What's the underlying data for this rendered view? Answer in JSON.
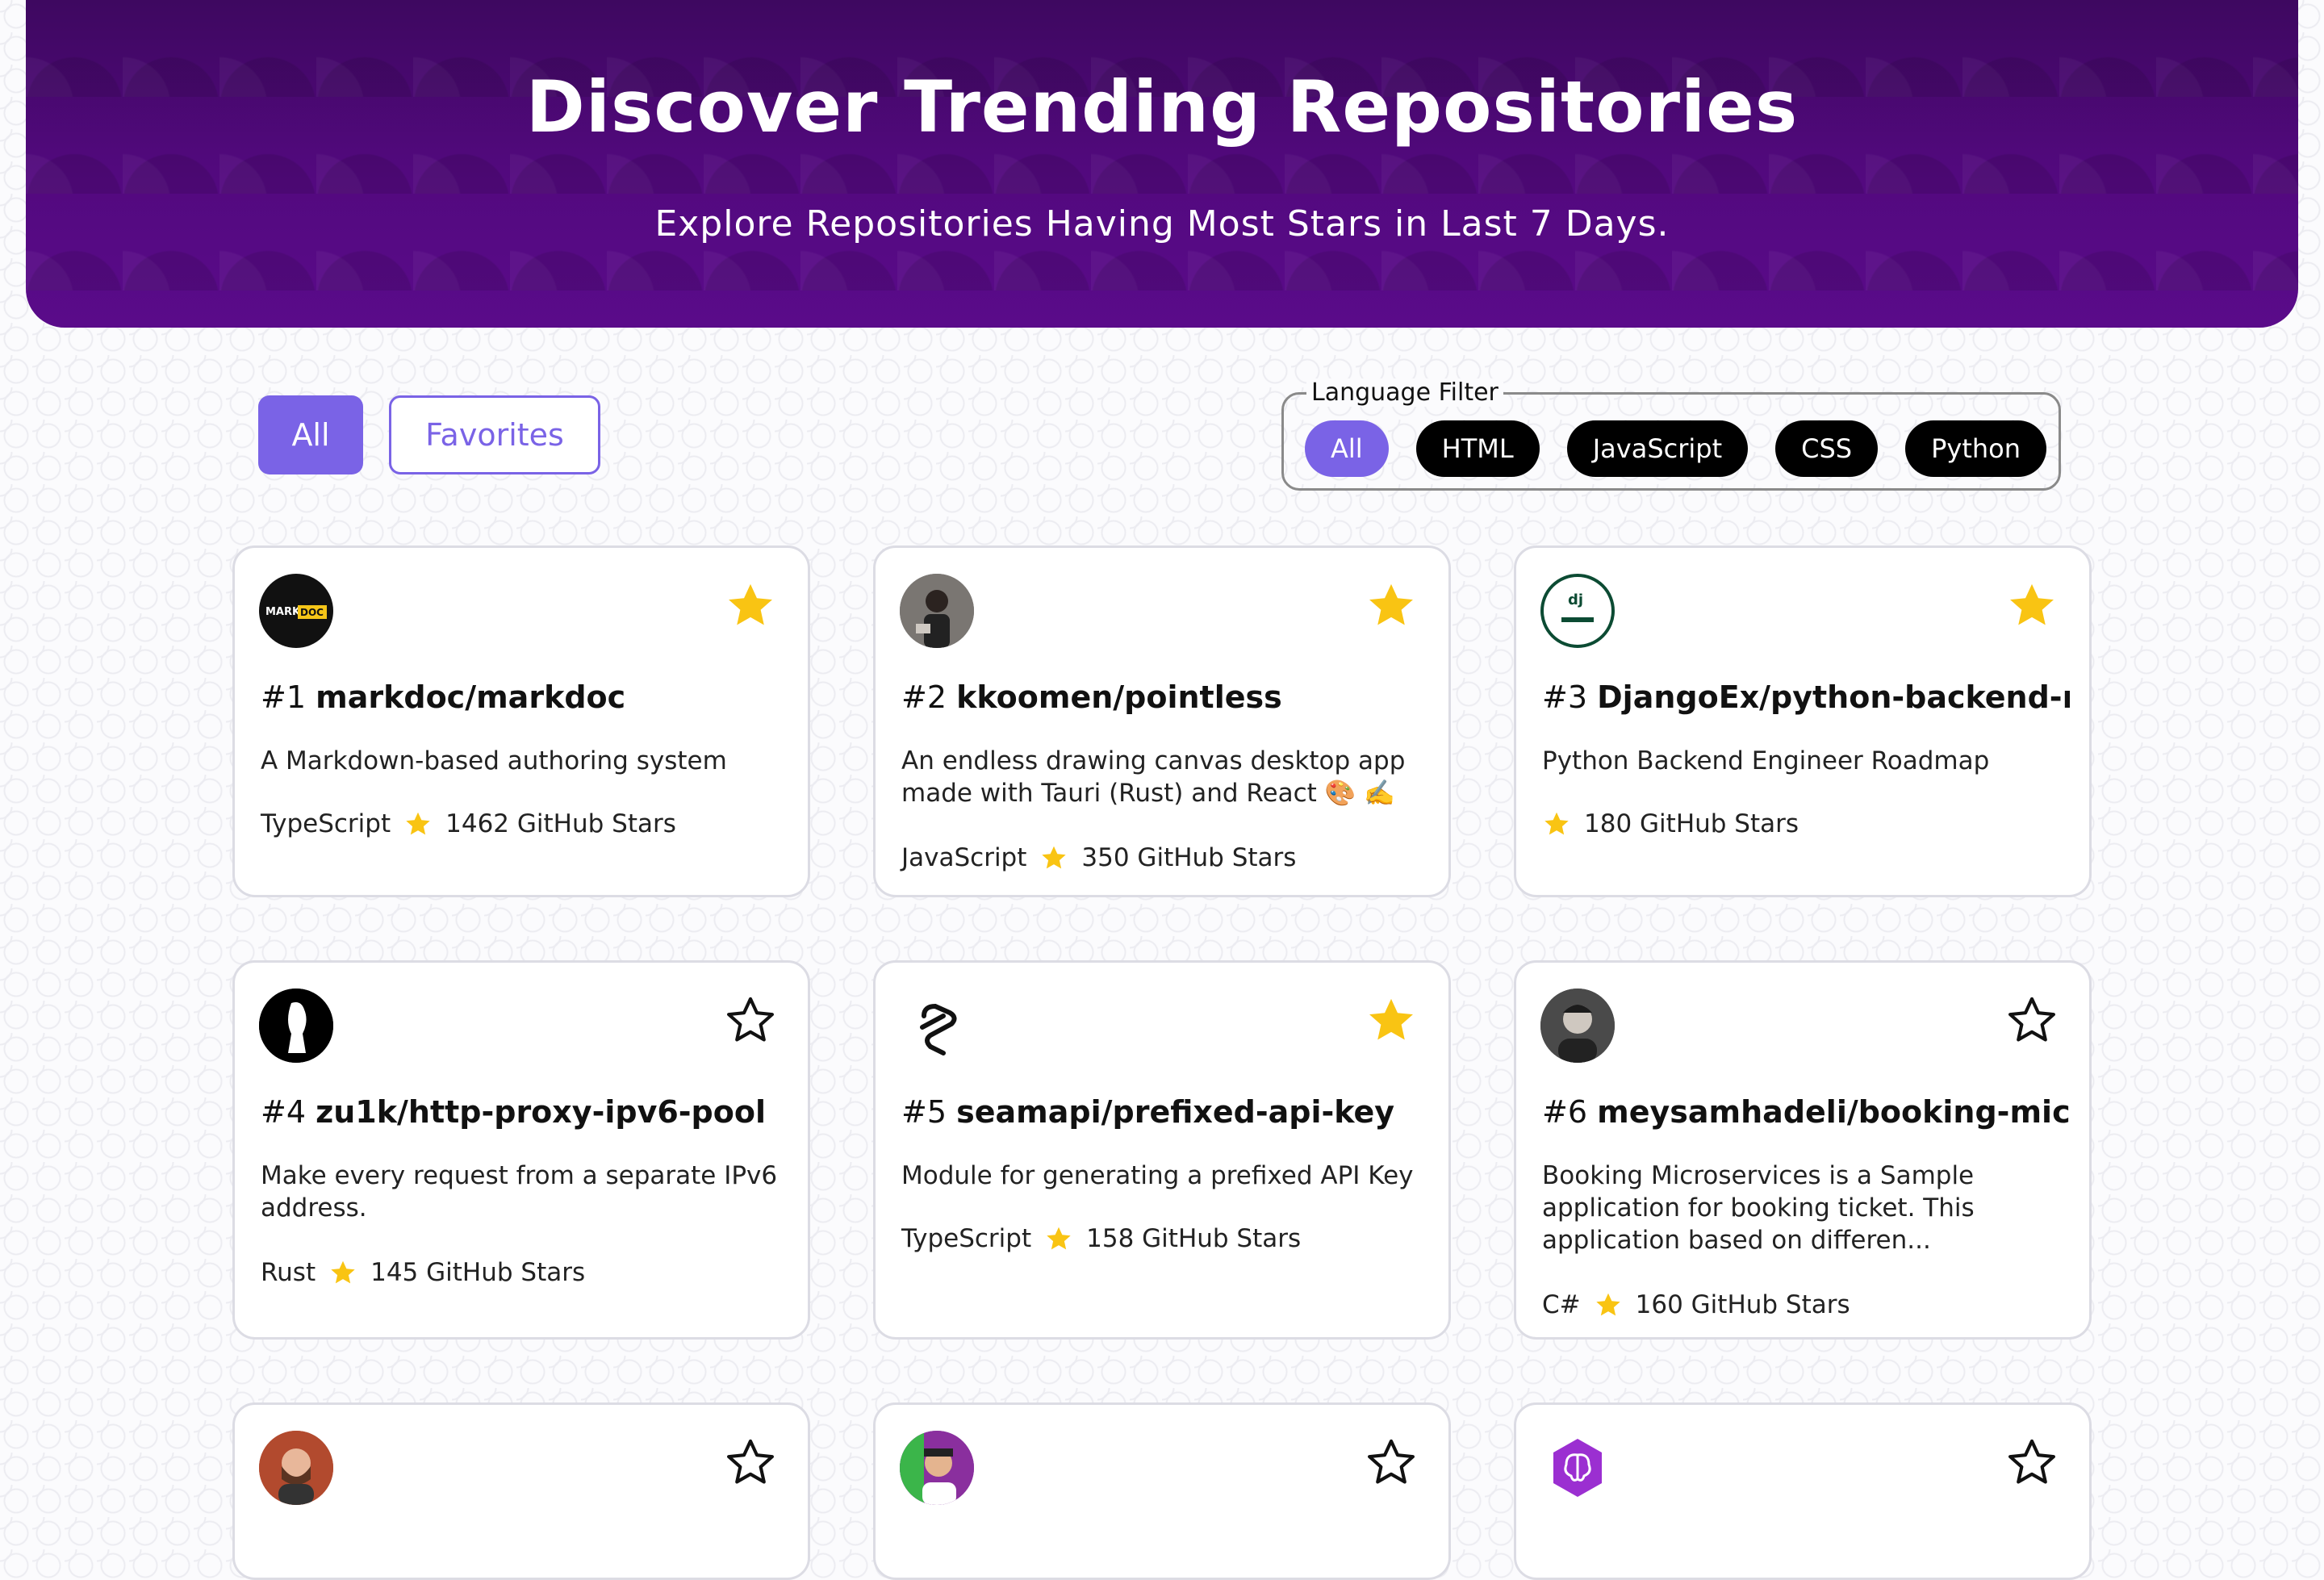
{
  "hero": {
    "title": "Discover Trending Repositories",
    "subtitle": "Explore Repositories Having Most Stars in Last 7 Days."
  },
  "view_tabs": {
    "all": "All",
    "favorites": "Favorites",
    "active": "All"
  },
  "language_filter": {
    "legend": "Language Filter",
    "options": [
      "All",
      "HTML",
      "JavaScript",
      "CSS",
      "Python"
    ],
    "selected": "All"
  },
  "colors": {
    "accent": "#7a63e6",
    "hero": "#4e0a79",
    "star": "#f9c413"
  },
  "repos": [
    {
      "rank": "#1",
      "name": "markdoc/markdoc",
      "description": "A Markdown-based authoring system",
      "language": "TypeScript",
      "stars": "1462 GitHub Stars",
      "favorite": true,
      "avatar_icon": "markdoc-logo"
    },
    {
      "rank": "#2",
      "name": "kkoomen/pointless",
      "description": "An endless drawing canvas desktop app made with Tauri (Rust) and React 🎨 ✍️",
      "language": "JavaScript",
      "stars": "350 GitHub Stars",
      "favorite": true,
      "avatar_icon": "user-avatar"
    },
    {
      "rank": "#3",
      "name": "DjangoEx/python-backend-r...",
      "description": "Python Backend Engineer Roadmap",
      "language": "",
      "stars": "180 GitHub Stars",
      "favorite": true,
      "avatar_icon": "django-logo"
    },
    {
      "rank": "#4",
      "name": "zu1k/http-proxy-ipv6-pool",
      "description": "Make every request from a separate IPv6 address.",
      "language": "Rust",
      "stars": "145 GitHub Stars",
      "favorite": false,
      "avatar_icon": "user-avatar"
    },
    {
      "rank": "#5",
      "name": "seamapi/prefixed-api-key",
      "description": "Module for generating a prefixed API Key",
      "language": "TypeScript",
      "stars": "158 GitHub Stars",
      "favorite": true,
      "avatar_icon": "seam-logo"
    },
    {
      "rank": "#6",
      "name": "meysamhadeli/booking-micr...",
      "description": "Booking Microservices is a Sample application for booking ticket. This application based on differen...",
      "language": "C#",
      "stars": "160 GitHub Stars",
      "favorite": false,
      "avatar_icon": "user-avatar"
    },
    {
      "rank": "",
      "name": "",
      "description": "",
      "language": "",
      "stars": "",
      "favorite": false,
      "avatar_icon": "user-avatar"
    },
    {
      "rank": "",
      "name": "",
      "description": "",
      "language": "",
      "stars": "",
      "favorite": false,
      "avatar_icon": "user-avatar"
    },
    {
      "rank": "",
      "name": "",
      "description": "",
      "language": "",
      "stars": "",
      "favorite": false,
      "avatar_icon": "brain-logo"
    }
  ]
}
